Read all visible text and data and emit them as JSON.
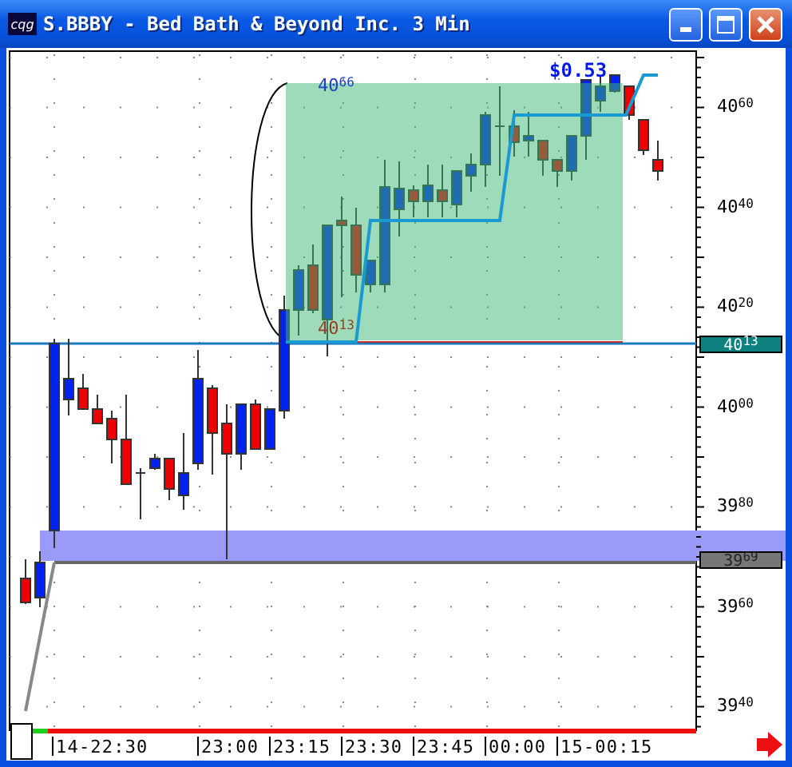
{
  "window": {
    "logo": "cqg",
    "title": "S.BBBY - Bed Bath & Beyond Inc. 3 Min"
  },
  "chart": {
    "move_label": "$0.53",
    "range_high_label": "40$^{66}$",
    "range_low_label": "40$^{13}$",
    "price_axis": [
      "40$^{60}$",
      "40$^{40}$",
      "40$^{20}$",
      "40$^{00}$",
      "39$^{80}$",
      "39$^{60}$",
      "39$^{40}$"
    ],
    "price_tags": [
      {
        "kind": "last",
        "text": "40$^{13}$"
      },
      {
        "kind": "level",
        "text": "39$^{69}$"
      }
    ],
    "time_axis": [
      "14-22:30",
      "23:00",
      "23:15",
      "23:30",
      "23:45",
      "00:00",
      "15-00:15"
    ]
  }
}
